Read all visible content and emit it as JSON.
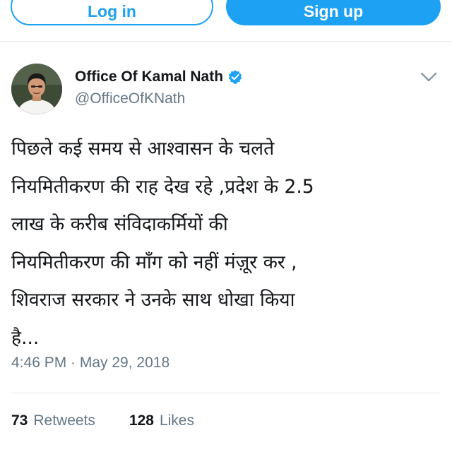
{
  "auth": {
    "login_label": "Log in",
    "signup_label": "Sign up"
  },
  "colors": {
    "accent": "#1da1f2",
    "text_primary": "#14171a",
    "text_secondary": "#657786",
    "divider": "#e1e8ed"
  },
  "tweet": {
    "author": {
      "display_name": "Office Of Kamal Nath",
      "handle": "@OfficeOfKNath",
      "verified": true,
      "avatar_icon": "profile-photo"
    },
    "menu_icon": "chevron-down-icon",
    "text": "पिछले कई समय से आश्वासन के चलते\nनियमितीकरण की राह देख रहे ,प्रदेश के 2.5\nलाख के करीब संविदाकर्मियों की\nनियमितीकरण की माँग को नहीं मंज़ूर कर ,\nशिवराज सरकार ने उनके साथ धोखा किया\nहै...",
    "timestamp": "4:46 PM · May 29, 2018",
    "stats": {
      "retweets_count": "73",
      "retweets_label": "Retweets",
      "likes_count": "128",
      "likes_label": "Likes"
    }
  }
}
